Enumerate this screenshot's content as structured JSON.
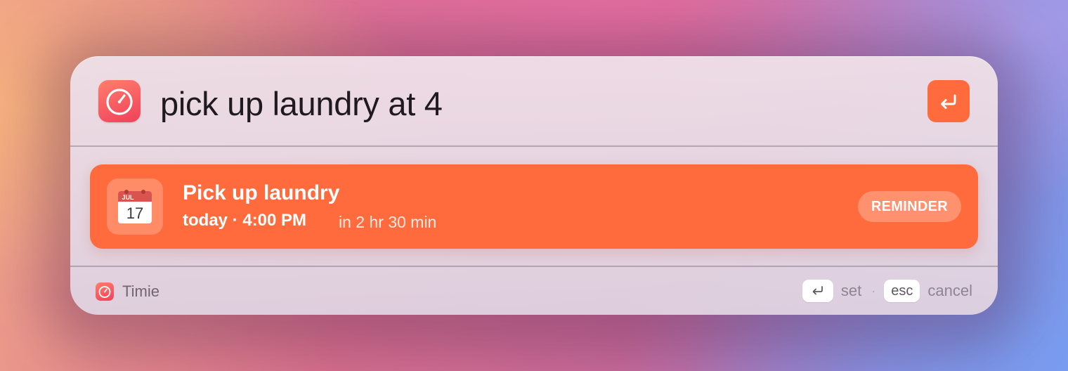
{
  "launcher": {
    "app_icon": "stopwatch-icon",
    "query": "pick up laundry at 4",
    "submit_icon": "return-arrow-icon"
  },
  "result": {
    "icon": "calendar-icon",
    "calendar_month": "JUL",
    "calendar_day": "17",
    "title": "Pick up laundry",
    "when": "today · 4:00 PM",
    "relative": "in 2 hr 30 min",
    "type_badge": "REMINDER"
  },
  "footer": {
    "app_icon": "stopwatch-icon",
    "app_name": "Timie",
    "hints": [
      {
        "key_icon": "return-arrow-icon",
        "label": "set"
      },
      {
        "key": "esc",
        "label": "cancel"
      }
    ],
    "separator": "·"
  },
  "colors": {
    "accent": "#ff6b3d",
    "app_icon_top": "#ff7e6b",
    "app_icon_bottom": "#f0415b"
  }
}
